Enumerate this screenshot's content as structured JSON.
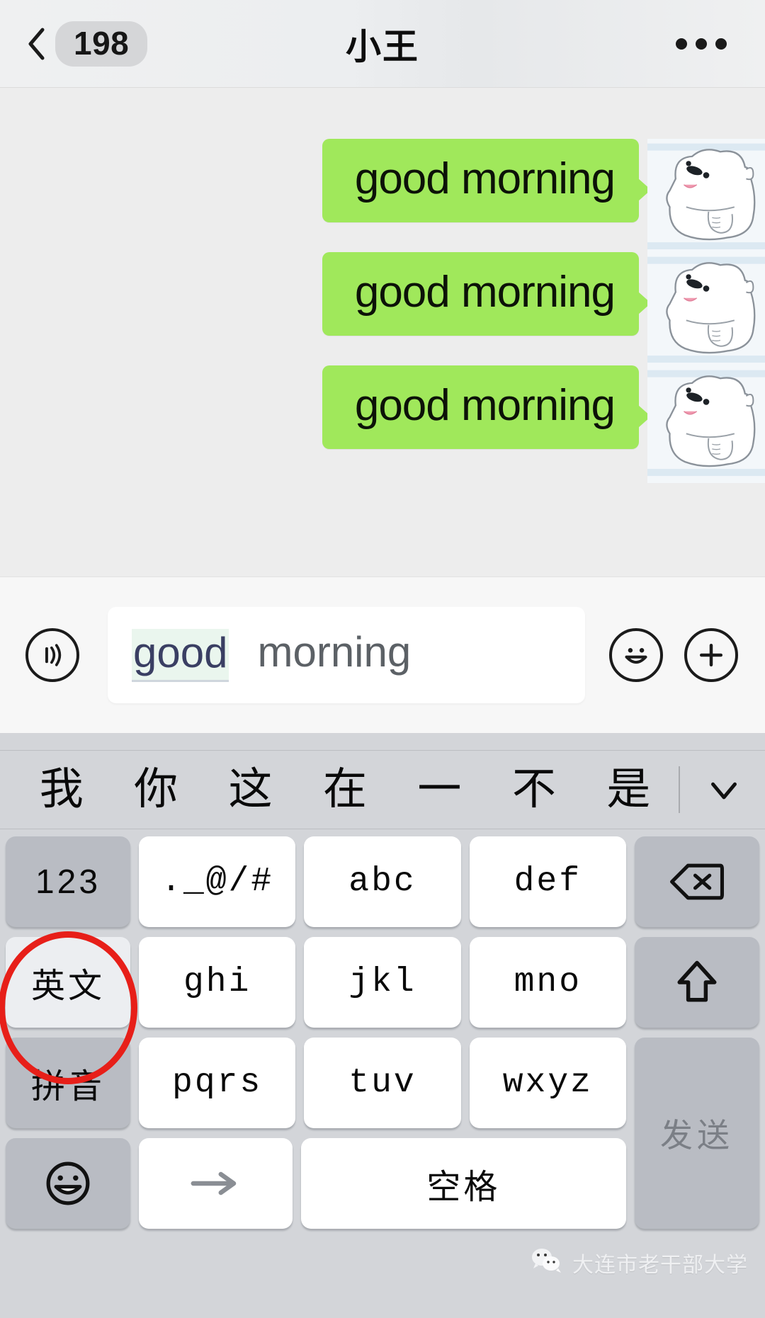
{
  "header": {
    "back_icon": "chevron-left-icon",
    "unread_count": "198",
    "title": "小王",
    "more_icon": "more-options-icon"
  },
  "chat": {
    "messages": [
      {
        "text": "good morning",
        "avatar": "polar-bear-sticker-avatar",
        "side": "right"
      },
      {
        "text": "good morning",
        "avatar": "polar-bear-sticker-avatar",
        "side": "right"
      },
      {
        "text": "good morning",
        "avatar": "polar-bear-sticker-avatar",
        "side": "right"
      }
    ],
    "bubble_color": "#a0e85b",
    "background_color": "#ededed"
  },
  "input_bar": {
    "voice_icon": "voice-input-icon",
    "composing_text": "good",
    "typed_text": "morning",
    "placeholder": "",
    "emoji_icon": "emoji-face-icon",
    "plus_icon": "plus-circle-icon"
  },
  "keyboard": {
    "candidates": [
      "我",
      "你",
      "这",
      "在",
      "一",
      "不",
      "是"
    ],
    "expand_icon": "chevron-down-icon",
    "rows": [
      [
        {
          "label": "123",
          "style": "gray",
          "name": "key-123"
        },
        {
          "label": "._@/#",
          "style": "white",
          "name": "key-symbols"
        },
        {
          "label": "abc",
          "style": "white",
          "name": "key-abc"
        },
        {
          "label": "def",
          "style": "white",
          "name": "key-def"
        },
        {
          "label": "⌫",
          "style": "gray",
          "name": "key-backspace"
        }
      ],
      [
        {
          "label": "英文",
          "style": "light",
          "name": "key-english-mode"
        },
        {
          "label": "ghi",
          "style": "white",
          "name": "key-ghi"
        },
        {
          "label": "jkl",
          "style": "white",
          "name": "key-jkl"
        },
        {
          "label": "mno",
          "style": "white",
          "name": "key-mno"
        },
        {
          "label": "⇧",
          "style": "gray",
          "name": "key-shift"
        }
      ],
      [
        {
          "label": "拼音",
          "style": "gray",
          "name": "key-pinyin-mode"
        },
        {
          "label": "pqrs",
          "style": "white",
          "name": "key-pqrs"
        },
        {
          "label": "tuv",
          "style": "white",
          "name": "key-tuv"
        },
        {
          "label": "wxyz",
          "style": "white",
          "name": "key-wxyz"
        }
      ],
      [
        {
          "label": "☺",
          "style": "gray",
          "name": "key-emoji"
        },
        {
          "label": "→",
          "style": "white",
          "name": "key-next"
        },
        {
          "label": "空格",
          "style": "white",
          "name": "key-space"
        }
      ]
    ],
    "send_label": "发送",
    "highlight_color": "#e71f19",
    "highlighted_key": "英文"
  },
  "watermark": {
    "logo_icon": "wechat-logo-icon",
    "text": "大连市老干部大学"
  }
}
